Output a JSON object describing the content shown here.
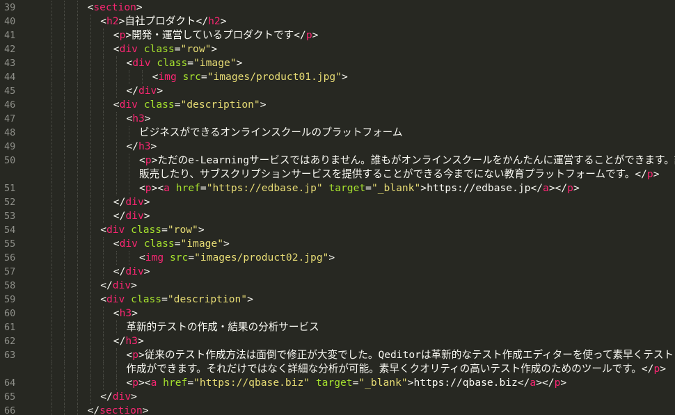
{
  "editor": {
    "theme": "monokai",
    "colors": {
      "background": "#272822",
      "tag": "#f92672",
      "attribute": "#a6e22e",
      "string": "#e6db74",
      "text": "#f8f8f2",
      "line_number": "#8f908a"
    },
    "lines": [
      {
        "n": "39",
        "indent": 6,
        "tokens": [
          [
            "pun",
            "<"
          ],
          [
            "tag",
            "section"
          ],
          [
            "pun",
            ">"
          ]
        ]
      },
      {
        "n": "40",
        "indent": 7,
        "tokens": [
          [
            "pun",
            "<"
          ],
          [
            "tag",
            "h2"
          ],
          [
            "pun",
            ">"
          ],
          [
            "txt",
            "自社プロダクト"
          ],
          [
            "pun",
            "</"
          ],
          [
            "tag",
            "h2"
          ],
          [
            "pun",
            ">"
          ]
        ]
      },
      {
        "n": "41",
        "indent": 8,
        "tokens": [
          [
            "pun",
            "<"
          ],
          [
            "tag",
            "p"
          ],
          [
            "pun",
            ">"
          ],
          [
            "txt",
            "開発・運営しているプロダクトです"
          ],
          [
            "pun",
            "</"
          ],
          [
            "tag",
            "p"
          ],
          [
            "pun",
            ">"
          ]
        ]
      },
      {
        "n": "42",
        "indent": 8,
        "tokens": [
          [
            "pun",
            "<"
          ],
          [
            "tag",
            "div"
          ],
          [
            "pun",
            " "
          ],
          [
            "attr",
            "class"
          ],
          [
            "pun",
            "="
          ],
          [
            "str",
            "\"row\""
          ],
          [
            "pun",
            ">"
          ]
        ]
      },
      {
        "n": "43",
        "indent": 9,
        "tokens": [
          [
            "pun",
            "<"
          ],
          [
            "tag",
            "div"
          ],
          [
            "pun",
            " "
          ],
          [
            "attr",
            "class"
          ],
          [
            "pun",
            "="
          ],
          [
            "str",
            "\"image\""
          ],
          [
            "pun",
            ">"
          ]
        ]
      },
      {
        "n": "44",
        "indent": 11,
        "tokens": [
          [
            "pun",
            "<"
          ],
          [
            "tag",
            "img"
          ],
          [
            "pun",
            " "
          ],
          [
            "attr",
            "src"
          ],
          [
            "pun",
            "="
          ],
          [
            "str",
            "\"images/product01.jpg\""
          ],
          [
            "pun",
            ">"
          ]
        ]
      },
      {
        "n": "45",
        "indent": 9,
        "tokens": [
          [
            "pun",
            "</"
          ],
          [
            "tag",
            "div"
          ],
          [
            "pun",
            ">"
          ]
        ]
      },
      {
        "n": "46",
        "indent": 8,
        "tokens": [
          [
            "pun",
            "<"
          ],
          [
            "tag",
            "div"
          ],
          [
            "pun",
            " "
          ],
          [
            "attr",
            "class"
          ],
          [
            "pun",
            "="
          ],
          [
            "str",
            "\"description\""
          ],
          [
            "pun",
            ">"
          ]
        ]
      },
      {
        "n": "47",
        "indent": 9,
        "tokens": [
          [
            "pun",
            "<"
          ],
          [
            "tag",
            "h3"
          ],
          [
            "pun",
            ">"
          ]
        ]
      },
      {
        "n": "48",
        "indent": 10,
        "tokens": [
          [
            "txt",
            "ビジネスができるオンラインスクールのプラットフォーム"
          ]
        ]
      },
      {
        "n": "49",
        "indent": 9,
        "tokens": [
          [
            "pun",
            "</"
          ],
          [
            "tag",
            "h3"
          ],
          [
            "pun",
            ">"
          ]
        ]
      },
      {
        "n": "50",
        "indent": 10,
        "tokens": [
          [
            "pun",
            "<"
          ],
          [
            "tag",
            "p"
          ],
          [
            "pun",
            ">"
          ],
          [
            "txt",
            "ただのe-Learningサービスではありません。誰もがオンラインスクールをかんたんに運営することができます。講座を"
          ]
        ]
      },
      {
        "n": "",
        "indent": 10,
        "tokens": [
          [
            "txt",
            "販売したり、サブスクリプションサービスを提供することができる今までにない教育プラットフォームです。"
          ],
          [
            "pun",
            "</"
          ],
          [
            "tag",
            "p"
          ],
          [
            "pun",
            ">"
          ]
        ]
      },
      {
        "n": "51",
        "indent": 10,
        "tokens": [
          [
            "pun",
            "<"
          ],
          [
            "tag",
            "p"
          ],
          [
            "pun",
            "><"
          ],
          [
            "tag",
            "a"
          ],
          [
            "pun",
            " "
          ],
          [
            "attr",
            "href"
          ],
          [
            "pun",
            "="
          ],
          [
            "str",
            "\"https://edbase.jp\""
          ],
          [
            "pun",
            " "
          ],
          [
            "attr",
            "target"
          ],
          [
            "pun",
            "="
          ],
          [
            "str",
            "\"_blank\""
          ],
          [
            "pun",
            ">"
          ],
          [
            "txt",
            "https://edbase.jp"
          ],
          [
            "pun",
            "</"
          ],
          [
            "tag",
            "a"
          ],
          [
            "pun",
            "></"
          ],
          [
            "tag",
            "p"
          ],
          [
            "pun",
            ">"
          ]
        ]
      },
      {
        "n": "52",
        "indent": 8,
        "tokens": [
          [
            "pun",
            "</"
          ],
          [
            "tag",
            "div"
          ],
          [
            "pun",
            ">"
          ]
        ]
      },
      {
        "n": "53",
        "indent": 8,
        "tokens": [
          [
            "pun",
            "</"
          ],
          [
            "tag",
            "div"
          ],
          [
            "pun",
            ">"
          ]
        ]
      },
      {
        "n": "54",
        "indent": 7,
        "tokens": [
          [
            "pun",
            "<"
          ],
          [
            "tag",
            "div"
          ],
          [
            "pun",
            " "
          ],
          [
            "attr",
            "class"
          ],
          [
            "pun",
            "="
          ],
          [
            "str",
            "\"row\""
          ],
          [
            "pun",
            ">"
          ]
        ]
      },
      {
        "n": "55",
        "indent": 8,
        "tokens": [
          [
            "pun",
            "<"
          ],
          [
            "tag",
            "div"
          ],
          [
            "pun",
            " "
          ],
          [
            "attr",
            "class"
          ],
          [
            "pun",
            "="
          ],
          [
            "str",
            "\"image\""
          ],
          [
            "pun",
            ">"
          ]
        ]
      },
      {
        "n": "56",
        "indent": 10,
        "tokens": [
          [
            "pun",
            "<"
          ],
          [
            "tag",
            "img"
          ],
          [
            "pun",
            " "
          ],
          [
            "attr",
            "src"
          ],
          [
            "pun",
            "="
          ],
          [
            "str",
            "\"images/product02.jpg\""
          ],
          [
            "pun",
            ">"
          ]
        ]
      },
      {
        "n": "57",
        "indent": 8,
        "tokens": [
          [
            "pun",
            "</"
          ],
          [
            "tag",
            "div"
          ],
          [
            "pun",
            ">"
          ]
        ]
      },
      {
        "n": "58",
        "indent": 7,
        "tokens": [
          [
            "pun",
            "</"
          ],
          [
            "tag",
            "div"
          ],
          [
            "pun",
            ">"
          ]
        ]
      },
      {
        "n": "59",
        "indent": 7,
        "tokens": [
          [
            "pun",
            "<"
          ],
          [
            "tag",
            "div"
          ],
          [
            "pun",
            " "
          ],
          [
            "attr",
            "class"
          ],
          [
            "pun",
            "="
          ],
          [
            "str",
            "\"description\""
          ],
          [
            "pun",
            ">"
          ]
        ]
      },
      {
        "n": "60",
        "indent": 8,
        "tokens": [
          [
            "pun",
            "<"
          ],
          [
            "tag",
            "h3"
          ],
          [
            "pun",
            ">"
          ]
        ]
      },
      {
        "n": "61",
        "indent": 9,
        "tokens": [
          [
            "txt",
            "革新的テストの作成・結果の分析サービス"
          ]
        ]
      },
      {
        "n": "62",
        "indent": 8,
        "tokens": [
          [
            "pun",
            "</"
          ],
          [
            "tag",
            "h3"
          ],
          [
            "pun",
            ">"
          ]
        ]
      },
      {
        "n": "63",
        "indent": 9,
        "tokens": [
          [
            "pun",
            "<"
          ],
          [
            "tag",
            "p"
          ],
          [
            "pun",
            ">"
          ],
          [
            "txt",
            "従来のテスト作成方法は面倒で修正が大変でした。Qeditorは革新的なテスト作成エディターを使って素早くテスト"
          ]
        ]
      },
      {
        "n": "",
        "indent": 9,
        "tokens": [
          [
            "txt",
            "作成ができます。それだけではなく詳細な分析が可能。素早くクオリティの高いテスト作成のためのツールです。"
          ],
          [
            "pun",
            "</"
          ],
          [
            "tag",
            "p"
          ],
          [
            "pun",
            ">"
          ]
        ]
      },
      {
        "n": "64",
        "indent": 9,
        "tokens": [
          [
            "pun",
            "<"
          ],
          [
            "tag",
            "p"
          ],
          [
            "pun",
            "><"
          ],
          [
            "tag",
            "a"
          ],
          [
            "pun",
            " "
          ],
          [
            "attr",
            "href"
          ],
          [
            "pun",
            "="
          ],
          [
            "str",
            "\"https://qbase.biz\""
          ],
          [
            "pun",
            " "
          ],
          [
            "attr",
            "target"
          ],
          [
            "pun",
            "="
          ],
          [
            "str",
            "\"_blank\""
          ],
          [
            "pun",
            ">"
          ],
          [
            "txt",
            "https://qbase.biz"
          ],
          [
            "pun",
            "</"
          ],
          [
            "tag",
            "a"
          ],
          [
            "pun",
            "></"
          ],
          [
            "tag",
            "p"
          ],
          [
            "pun",
            ">"
          ]
        ]
      },
      {
        "n": "65",
        "indent": 7,
        "tokens": [
          [
            "pun",
            "</"
          ],
          [
            "tag",
            "div"
          ],
          [
            "pun",
            ">"
          ]
        ]
      },
      {
        "n": "66",
        "indent": 6,
        "tokens": [
          [
            "pun",
            "</"
          ],
          [
            "tag",
            "section"
          ],
          [
            "pun",
            ">"
          ]
        ]
      }
    ]
  }
}
